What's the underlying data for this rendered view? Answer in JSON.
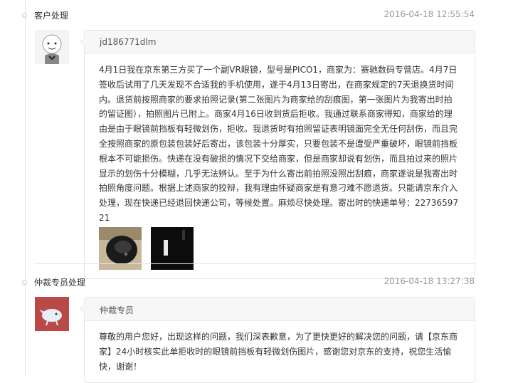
{
  "entries": [
    {
      "role": "客户处理",
      "time": "2016-04-18 12:55:54",
      "author": "jd186771dlm",
      "text": "4月1日我在京东第三方买了一个副VR眼镜，型号是PICO1，商家为：赛驰数码专营店。4月7日签收后试用了几天发现不合适我的手机使用，遂于4月13日寄出，在商家规定的7天退换货时间内。退货前按照商家的要求拍照记录(第二张图片为商家给的刮痕图，第一张图片为我寄出时拍的留证图），拍照图片已附上。商家4月16日收到货后拒收。我通过联系商家得知，商家给的理由是由于眼镜前挡板有轻微划伤，拒收。我退货时有拍照留证表明镜面完全无任何刮伤，而且完全按照商家的原包装包装好后寄出，该包装十分厚实，只要包装不是遭受严重破坏，眼镜前挡板根本不可能损伤。快递在没有破损的情况下交给商家，但是商家却说有划伤，而且拍过来的照片显示的划伤十分模糊，几乎无法辨认。至于为什么寄出前拍照没照出刮痕，商家遂说是我寄出时拍照角度问题。根据上述商家的狡辩，我有理由怀疑商家是有意刁难不愿退货。只能请京东介入处理，现在快递已经退回快递公司，等候处置。麻烦尽快处理。寄出时的快递单号：2273659721",
      "images": [
        "vr-headset-photo",
        "scratch-photo"
      ]
    },
    {
      "role": "仲裁专员处理",
      "time": "2016-04-18 13:27:38",
      "author": "仲裁专员",
      "text": "尊敬的用户您好，出现这样的问题，我们深表歉意，为了更快更好的解决您的问题，请【京东商家】24小时核实此单拒收时的眼镜前挡板有轻微划伤图片，感谢您对京东的支持，祝您生活愉快，谢谢！"
    }
  ],
  "colors": {
    "line": "#e3e3e3",
    "bubble_head": "#f7f7f7",
    "time": "#999999",
    "agent_avatar": "#b94a48"
  }
}
